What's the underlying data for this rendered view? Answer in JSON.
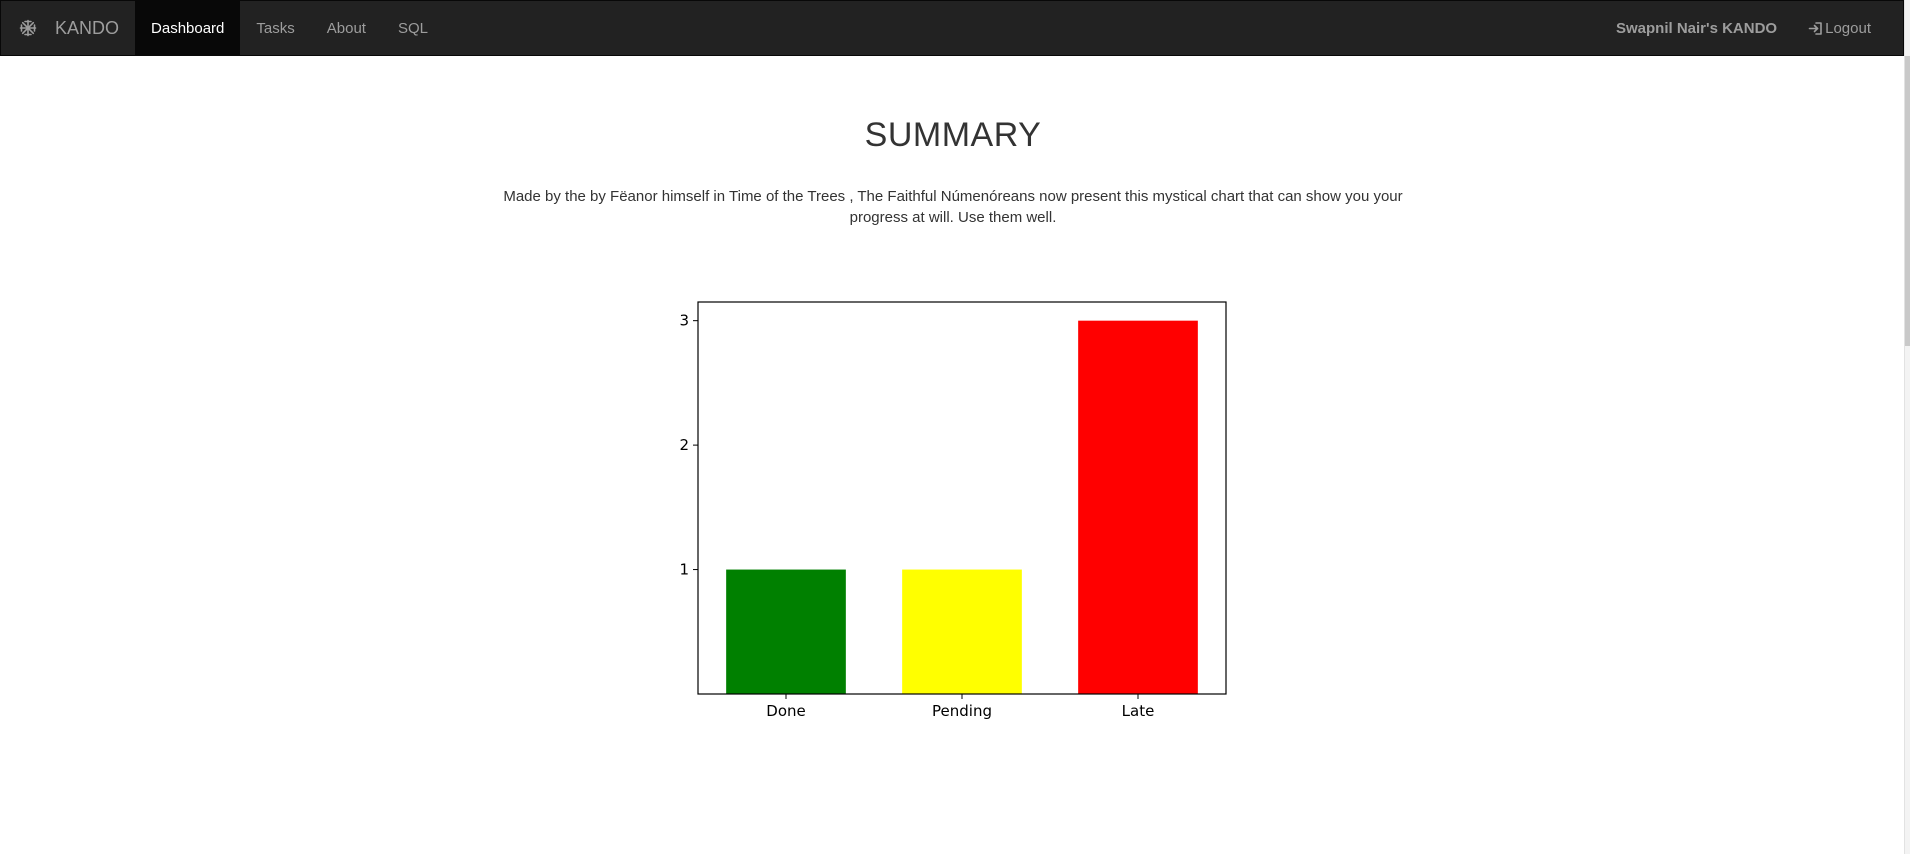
{
  "navbar": {
    "brand_label": "KANDO",
    "brand_icon": "asterisk-snowflake-icon",
    "items": [
      {
        "label": "Dashboard",
        "active": true
      },
      {
        "label": "Tasks",
        "active": false
      },
      {
        "label": "About",
        "active": false
      },
      {
        "label": "SQL",
        "active": false
      }
    ],
    "user_label": "Swapnil Nair's KANDO",
    "logout_label": "Logout",
    "logout_icon": "log-in-arrow-icon",
    "background_color": "#222222",
    "active_item_color": "#080808"
  },
  "main": {
    "title": "SUMMARY",
    "description": "Made by the by Fëanor himself in Time of the Trees , The Faithful Númenóreans now present this mystical chart that can show you your progress at will. Use them well."
  },
  "chart_data": {
    "type": "bar",
    "categories": [
      "Done",
      "Pending",
      "Late"
    ],
    "values": [
      1,
      1,
      3
    ],
    "colors": [
      "#008000",
      "#ffff00",
      "#ff0000"
    ],
    "yticks": [
      1,
      2,
      3
    ],
    "ylim": [
      0,
      3.15
    ],
    "title": "",
    "xlabel": "",
    "ylabel": "",
    "grid": false
  }
}
